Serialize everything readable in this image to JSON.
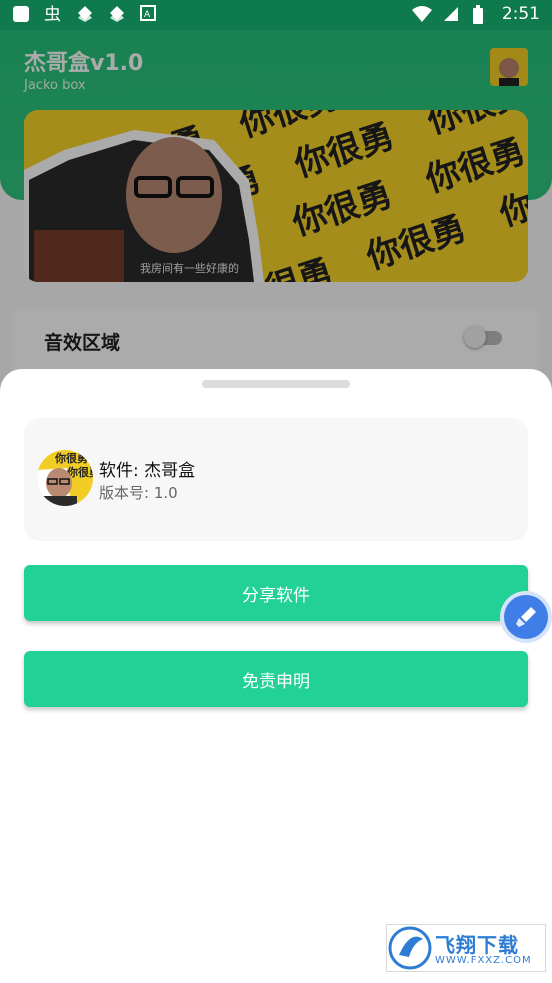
{
  "status_bar": {
    "time": "2:51"
  },
  "app": {
    "title": "杰哥盒v1.0",
    "subtitle": "Jacko box"
  },
  "banner": {
    "caption": "我房间有一些好康的",
    "pattern_text": "你很勇"
  },
  "section": {
    "title": "音效区域",
    "toggle_on": false
  },
  "sheet": {
    "software_label": "软件: 杰哥盒",
    "version_label": "版本号: 1.0",
    "share_button": "分享软件",
    "disclaimer_button": "免责申明"
  },
  "watermark": {
    "text": "飞翔下载",
    "url": "WWW.FXXZ.COM"
  },
  "colors": {
    "header": "#2ec27e",
    "button": "#22d196",
    "fab": "#3f7ee6"
  }
}
